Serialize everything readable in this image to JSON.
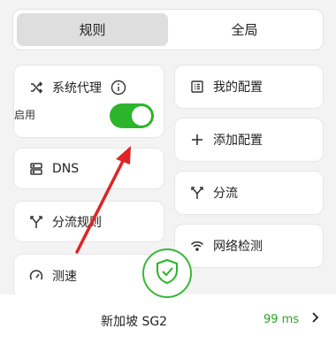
{
  "mode_switch": {
    "rule_label": "规则",
    "global_label": "全局"
  },
  "system_proxy": {
    "label": "系统代理",
    "enable_label": "启用",
    "enabled": true
  },
  "left_cards": {
    "dns_label": "DNS",
    "split_rules_label": "分流规则",
    "speed_test_label": "测速"
  },
  "right_cards": {
    "my_config_label": "我的配置",
    "add_config_label": "添加配置",
    "split_label": "分流",
    "network_check_label": "网络检测"
  },
  "footer": {
    "node_name": "新加坡 SG2",
    "latency": "99 ms"
  },
  "colors": {
    "accent_green": "#2bb52b",
    "latency_green": "#22a822",
    "annotation_red": "#e02424"
  }
}
